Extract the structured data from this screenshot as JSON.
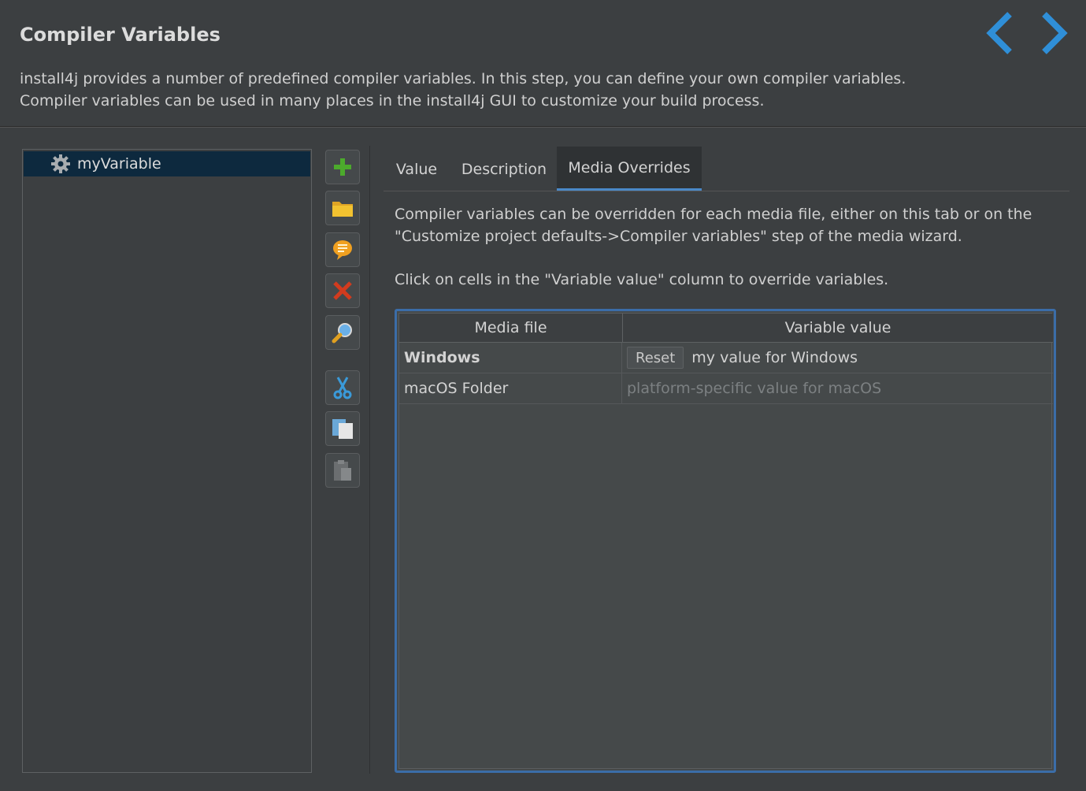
{
  "header": {
    "title": "Compiler Variables",
    "description": "install4j provides a number of predefined compiler variables. In this step, you can define your own compiler variables. Compiler variables can be used in many places in the install4j GUI to customize your build process."
  },
  "navigation": {
    "back_icon": "chevron-left-icon",
    "forward_icon": "chevron-right-icon",
    "accent_color": "#2f8fd8"
  },
  "tree": {
    "items": [
      {
        "label": "myVariable",
        "icon": "gear-icon",
        "selected": true
      }
    ]
  },
  "toolbar": {
    "buttons": [
      {
        "name": "add-button",
        "icon": "plus-icon"
      },
      {
        "name": "add-group-button",
        "icon": "folder-icon"
      },
      {
        "name": "add-comment-button",
        "icon": "comment-icon"
      },
      {
        "name": "delete-button",
        "icon": "delete-x-icon"
      },
      {
        "name": "show-usages-button",
        "icon": "magnifier-icon"
      },
      {
        "name": "cut-button",
        "icon": "scissors-icon"
      },
      {
        "name": "copy-button",
        "icon": "copy-icon"
      },
      {
        "name": "paste-button",
        "icon": "clipboard-icon",
        "enabled": false
      }
    ]
  },
  "tabs": [
    {
      "label": "Value",
      "active": false
    },
    {
      "label": "Description",
      "active": false
    },
    {
      "label": "Media Overrides",
      "active": true
    }
  ],
  "media_overrides": {
    "info_text": "Compiler variables can be overridden for each media file, either on this tab or on the \"Customize project defaults->Compiler variables\" step of the media wizard.",
    "info_text_2": "Click on cells in the \"Variable value\" column to override variables.",
    "columns": [
      "Media file",
      "Variable value"
    ],
    "rows": [
      {
        "media_file": "Windows",
        "bold": true,
        "reset_label": "Reset",
        "value": "my value for Windows",
        "overridden": true
      },
      {
        "media_file": "macOS Folder",
        "bold": false,
        "value": "platform-specific value for macOS",
        "overridden": false
      }
    ]
  }
}
